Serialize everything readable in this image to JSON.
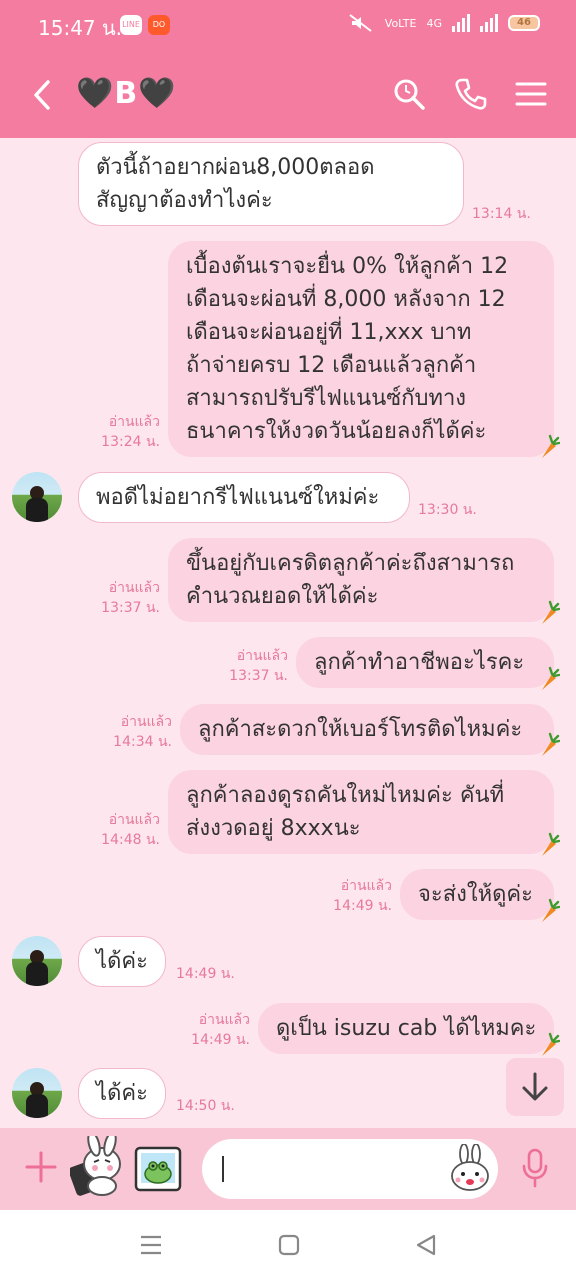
{
  "status_bar": {
    "time": "15:47 น.",
    "line_badge": "LINE",
    "app_badge": "DO",
    "network": "VoLTE",
    "network_type": "4G",
    "battery": "46"
  },
  "header": {
    "title": "🖤B🖤"
  },
  "messages": [
    {
      "side": "them",
      "lines": [
        "ตัวนี้ถ้าอยากผ่อน8,000ตลอด",
        "สัญญาต้องทำไงค่ะ"
      ],
      "time": "13:14 น."
    },
    {
      "side": "me",
      "lines": [
        "เบื้องต้นเราจะยื่น 0% ให้ลูกค้า 12",
        "เดือนจะผ่อนที่ 8,000 หลังจาก 12",
        "เดือนจะผ่อนอยู่ที่ 11,xxx  บาท",
        "ถ้าจ่ายครบ 12 เดือนแล้วลูกค้า",
        "สามารถปรับรีไฟแนนซ์กับทาง",
        "ธนาคารให้งวดวันน้อยลงก็ได้ค่ะ"
      ],
      "read": "อ่านแล้ว",
      "time": "13:24 น."
    },
    {
      "side": "them",
      "lines": [
        "พอดีไม่อยากรีไฟแนนซ์ใหม่ค่ะ"
      ],
      "time": "13:30 น."
    },
    {
      "side": "me",
      "lines": [
        "ขึ้นอยู่กับเครดิตลูกค้าค่ะถึงสามารถ",
        "คำนวณยอดให้ได้ค่ะ"
      ],
      "read": "อ่านแล้ว",
      "time": "13:37 น."
    },
    {
      "side": "me",
      "lines": [
        "ลูกค้าทำอาชีพอะไรคะ"
      ],
      "read": "อ่านแล้ว",
      "time": "13:37 น."
    },
    {
      "side": "me",
      "lines": [
        "ลูกค้าสะดวกให้เบอร์โทรติดไหมค่ะ"
      ],
      "read": "อ่านแล้ว",
      "time": "14:34 น."
    },
    {
      "side": "me",
      "lines": [
        "ลูกค้าลองดูรถคันใหม่ไหมค่ะ คันที่",
        "ส่งงวดอยู่ 8xxxนะ"
      ],
      "read": "อ่านแล้ว",
      "time": "14:48 น."
    },
    {
      "side": "me",
      "lines": [
        "จะส่งให้ดูค่ะ"
      ],
      "read": "อ่านแล้ว",
      "time": "14:49 น."
    },
    {
      "side": "them",
      "lines": [
        "ได้ค่ะ"
      ],
      "time": "14:49 น."
    },
    {
      "side": "me",
      "lines": [
        "ดูเป็น isuzu cab ได้ไหมคะ"
      ],
      "read": "อ่านแล้ว",
      "time": "14:49 น."
    },
    {
      "side": "them",
      "lines": [
        "ได้ค่ะ"
      ],
      "time": "14:50 น."
    }
  ],
  "input": {
    "value": "",
    "placeholder": ""
  },
  "icons": {
    "back": "chevron-left-icon",
    "search": "search-icon",
    "call": "phone-icon",
    "menu": "menu-icon",
    "plus": "plus-icon",
    "sticker": "sticker-icon",
    "gallery": "gallery-icon",
    "emoji": "emoji-icon",
    "mic": "mic-icon",
    "scroll": "arrow-down-icon",
    "read_marker": "carrot-icon"
  },
  "colors": {
    "header": "#f47ca1",
    "background": "#fde6ee",
    "my_bubble": "#fcd3e1",
    "their_bubble": "#ffffff",
    "meta_text": "#e7799c",
    "input_bar": "#f9c6d6"
  }
}
